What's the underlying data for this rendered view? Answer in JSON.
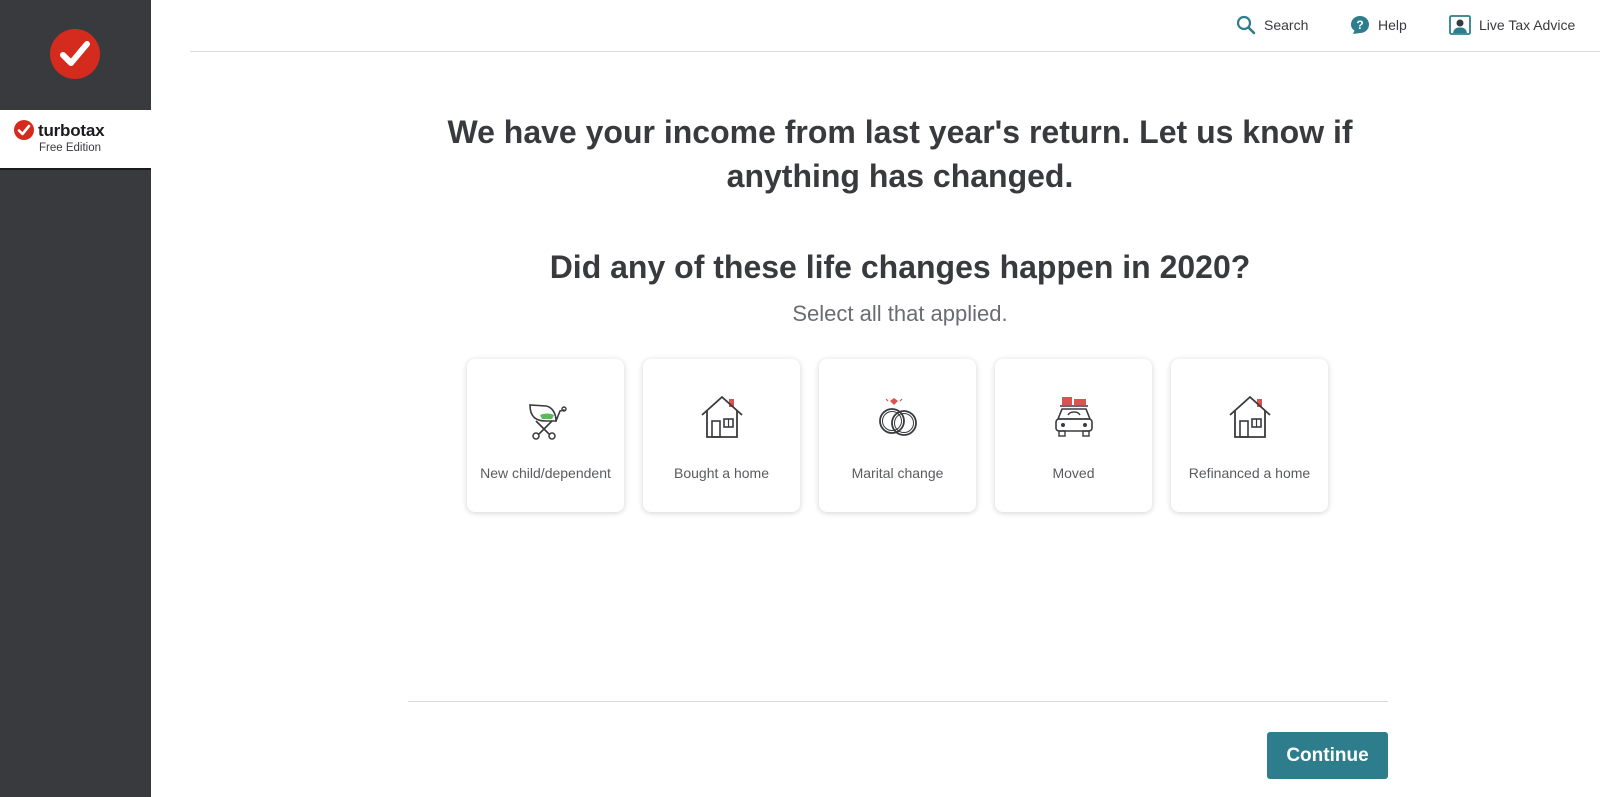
{
  "brand": {
    "name": "turbotax",
    "edition": "Free Edition"
  },
  "topbar": {
    "search_label": "Search",
    "help_label": "Help",
    "advice_label": "Live Tax Advice"
  },
  "main": {
    "headline": "We have your income from last year's return. Let us know if anything has changed.",
    "question": "Did any of these life changes happen in 2020?",
    "subhead": "Select all that applied.",
    "cards": [
      {
        "label": "New child/dependent",
        "icon": "stroller-icon"
      },
      {
        "label": "Bought a home",
        "icon": "house-icon"
      },
      {
        "label": "Marital change",
        "icon": "rings-icon"
      },
      {
        "label": "Moved",
        "icon": "moving-car-icon"
      },
      {
        "label": "Refinanced a home",
        "icon": "house-icon"
      }
    ]
  },
  "footer": {
    "continue_label": "Continue"
  },
  "colors": {
    "sidebar": "#393a3d",
    "brand_red": "#d52b1e",
    "primary_button": "#2e7d8c",
    "icon_teal": "#2e7d8c"
  }
}
